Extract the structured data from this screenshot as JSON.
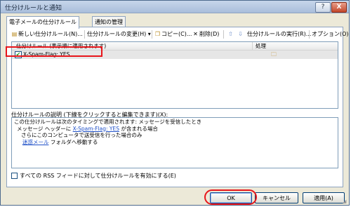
{
  "window": {
    "title": "仕分けルールと通知",
    "help_label": "?",
    "close_label": "X"
  },
  "tabs": [
    {
      "label": "電子メールの仕分けルール"
    },
    {
      "label": "通知の管理"
    }
  ],
  "toolbar": {
    "new_label": "新しい仕分けルール(N)...",
    "change_label": "仕分けルールの変更(H)",
    "copy_label": "コピー(C)...",
    "delete_label": "削除(D)",
    "run_label": "仕分けルールの実行(R)...",
    "options_label": "オプション(O)"
  },
  "rules_list": {
    "col_rule": "仕分けルール (表示順に適用されます)",
    "col_action": "処理",
    "rows": [
      {
        "name": "X-Spam-Flag: YES",
        "checked": true
      }
    ]
  },
  "description": {
    "label": "仕分けルールの説明 (下線をクリックすると編集できます)(X):",
    "line1": "この仕分けルールは次のタイミングで適用されます: メッセージを受信したとき",
    "line2_prefix": "メッセージ ヘッダーに",
    "line2_link": "X-Spam-Flag: YES",
    "line2_suffix": "が含まれる場合",
    "line3": "さらにこのコンピュータで送受信を行った場合のみ",
    "line4_link": "迷惑メール",
    "line4_suffix": "フォルダへ移動する"
  },
  "rss_option": {
    "label": "すべての RSS フィードに対して仕分けルールを有効にする(E)",
    "checked": false
  },
  "buttons": {
    "ok": "OK",
    "cancel": "キャンセル",
    "apply": "適用(A)"
  },
  "colors": {
    "highlight_red": "#e8161b",
    "link_blue": "#1f50c8",
    "check_green": "#21a121"
  }
}
